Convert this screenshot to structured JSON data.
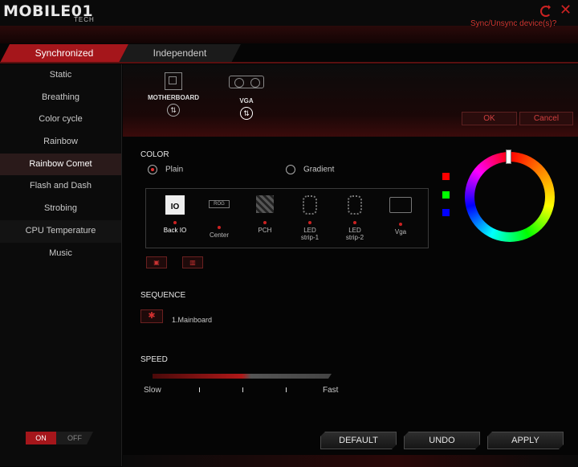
{
  "app": {
    "logo": "MOBILE01",
    "logo_sub": "TECH"
  },
  "colors": {
    "accent": "#a5161b",
    "text_red": "#d8342f"
  },
  "tabs": [
    {
      "label": "Synchronized",
      "active": true
    },
    {
      "label": "Independent",
      "active": false
    }
  ],
  "sidebar": {
    "items": [
      {
        "label": "Static"
      },
      {
        "label": "Breathing"
      },
      {
        "label": "Color cycle"
      },
      {
        "label": "Rainbow"
      },
      {
        "label": "Rainbow Comet"
      },
      {
        "label": "Flash and Dash"
      },
      {
        "label": "Strobing"
      },
      {
        "label": "CPU Temperature"
      },
      {
        "label": "Music"
      }
    ],
    "active_index": 4
  },
  "power": {
    "on_label": "ON",
    "off_label": "OFF"
  },
  "devices": [
    {
      "label": "MOTHERBOARD",
      "icon": "motherboard-icon"
    },
    {
      "label": "VGA",
      "icon": "graphics-card-icon"
    }
  ],
  "sync": {
    "question": "Sync/Unsync device(s)?",
    "ok_label": "OK",
    "cancel_label": "Cancel"
  },
  "color": {
    "heading": "COLOR",
    "plain_label": "Plain",
    "gradient_label": "Gradient",
    "selected_mode": "Plain",
    "swatches": [
      "#ff0000",
      "#00ff00",
      "#0000ff"
    ]
  },
  "zones": [
    {
      "label": "Back IO",
      "line2": "",
      "icon": "io-icon"
    },
    {
      "label": "Center",
      "line2": "",
      "icon": "rog-logo-icon"
    },
    {
      "label": "PCH",
      "line2": "",
      "icon": "chipset-icon"
    },
    {
      "label": "LED",
      "line2": "strip-1",
      "icon": "led-strip-icon"
    },
    {
      "label": "LED",
      "line2": "strip-2",
      "icon": "led-strip-icon"
    },
    {
      "label": "Vga",
      "line2": "",
      "icon": "graphics-card-icon"
    }
  ],
  "sequence": {
    "heading": "SEQUENCE",
    "item": "1.Mainboard"
  },
  "speed": {
    "heading": "SPEED",
    "slow_label": "Slow",
    "fast_label": "Fast",
    "level": 0.5
  },
  "bottom": {
    "default_label": "DEFAULT",
    "undo_label": "UNDO",
    "apply_label": "APPLY"
  }
}
